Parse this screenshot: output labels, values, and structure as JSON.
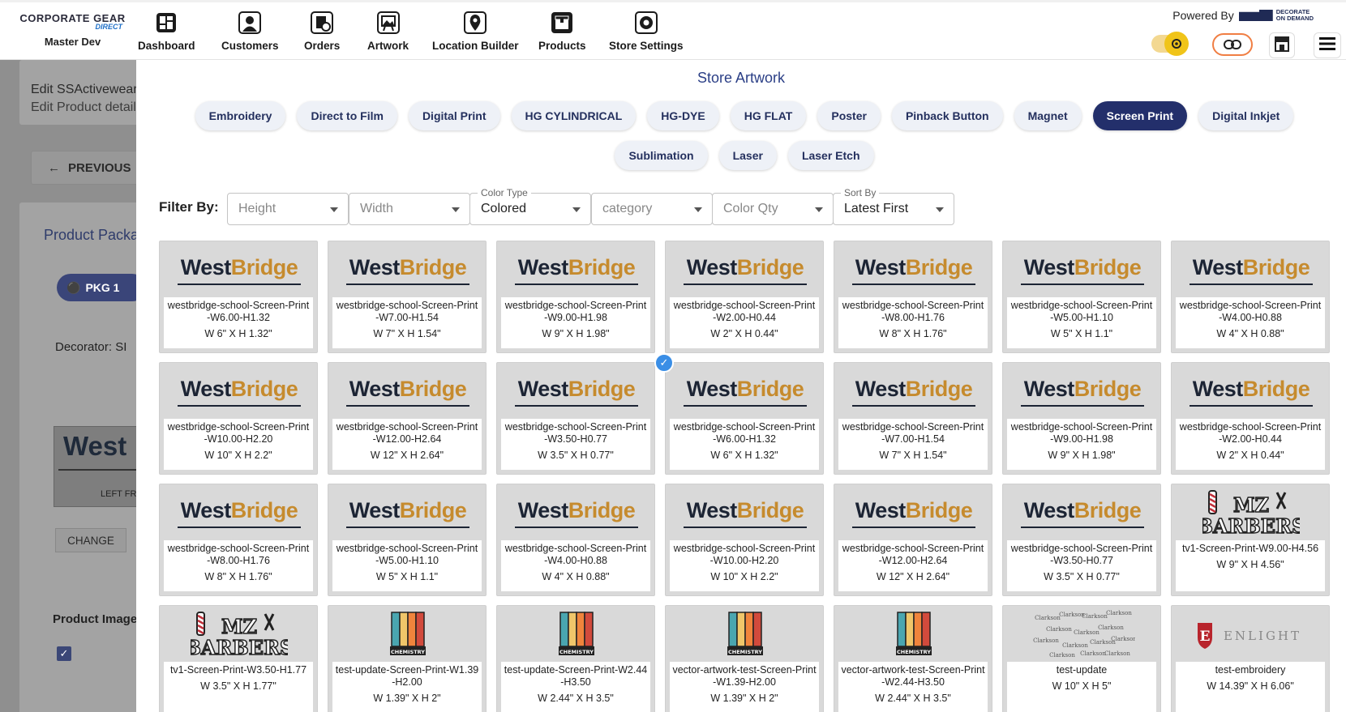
{
  "brand": {
    "name": "CORPORATE GEAR",
    "sub": "DIRECT",
    "store": "Master Dev"
  },
  "nav": [
    {
      "label": "Dashboard",
      "icon": "dashboard-icon"
    },
    {
      "label": "Customers",
      "icon": "customers-icon"
    },
    {
      "label": "Orders",
      "icon": "orders-icon"
    },
    {
      "label": "Artwork",
      "icon": "artwork-icon"
    },
    {
      "label": "Location Builder",
      "icon": "location-pin-icon"
    },
    {
      "label": "Products",
      "icon": "products-icon"
    },
    {
      "label": "Store Settings",
      "icon": "store-settings-icon"
    }
  ],
  "powered_by": {
    "text": "Powered By",
    "logo_line1": "DECORATE",
    "logo_line2": "ON DEMAND"
  },
  "background": {
    "edit_title": "Edit SSActivewear",
    "edit_sub": "Edit Product details",
    "previous": "PREVIOUS",
    "product_pack": "Product Package",
    "pkg": "PKG 1",
    "decorator": "Decorator: SI",
    "thumb_word": "West",
    "thumb_left": "LEFT FR",
    "change": "CHANGE",
    "product_images": "Product Images"
  },
  "panel": {
    "title": "Store Artwork",
    "tabs": [
      "Embroidery",
      "Direct to Film",
      "Digital Print",
      "HG CYLINDRICAL",
      "HG-DYE",
      "HG FLAT",
      "Poster",
      "Pinback Button",
      "Magnet",
      "Screen Print",
      "Digital Inkjet",
      "Sublimation",
      "Laser",
      "Laser Etch"
    ],
    "active_tab": "Screen Print",
    "filter_label": "Filter By:",
    "filters": [
      {
        "caption": "",
        "value": "Height",
        "placeholder": true
      },
      {
        "caption": "",
        "value": "Width",
        "placeholder": true
      },
      {
        "caption": "Color Type",
        "value": "Colored",
        "placeholder": false
      },
      {
        "caption": "",
        "value": "category",
        "placeholder": true
      },
      {
        "caption": "",
        "value": "Color Qty",
        "placeholder": true
      },
      {
        "caption": "Sort By",
        "value": "Latest First",
        "placeholder": false
      }
    ]
  },
  "artworks": [
    {
      "art": "westbridge",
      "name": "westbridge-school-Screen-Print-W6.00-H1.32",
      "dims": "W 6\" X H 1.32\"",
      "selected": false
    },
    {
      "art": "westbridge",
      "name": "westbridge-school-Screen-Print-W7.00-H1.54",
      "dims": "W 7\" X H 1.54\"",
      "selected": false
    },
    {
      "art": "westbridge",
      "name": "westbridge-school-Screen-Print-W9.00-H1.98",
      "dims": "W 9\" X H 1.98\"",
      "selected": false
    },
    {
      "art": "westbridge",
      "name": "westbridge-school-Screen-Print-W2.00-H0.44",
      "dims": "W 2\" X H 0.44\"",
      "selected": false
    },
    {
      "art": "westbridge",
      "name": "westbridge-school-Screen-Print-W8.00-H1.76",
      "dims": "W 8\" X H 1.76\"",
      "selected": false
    },
    {
      "art": "westbridge",
      "name": "westbridge-school-Screen-Print-W5.00-H1.10",
      "dims": "W 5\" X H 1.1\"",
      "selected": false
    },
    {
      "art": "westbridge",
      "name": "westbridge-school-Screen-Print-W4.00-H0.88",
      "dims": "W 4\" X H 0.88\"",
      "selected": false
    },
    {
      "art": "westbridge",
      "name": "westbridge-school-Screen-Print-W10.00-H2.20",
      "dims": "W 10\" X H 2.2\"",
      "selected": false
    },
    {
      "art": "westbridge",
      "name": "westbridge-school-Screen-Print-W12.00-H2.64",
      "dims": "W 12\" X H 2.64\"",
      "selected": false
    },
    {
      "art": "westbridge",
      "name": "westbridge-school-Screen-Print-W3.50-H0.77",
      "dims": "W 3.5\" X H 0.77\"",
      "selected": false
    },
    {
      "art": "westbridge",
      "name": "westbridge-school-Screen-Print-W6.00-H1.32",
      "dims": "W 6\" X H 1.32\"",
      "selected": true
    },
    {
      "art": "westbridge",
      "name": "westbridge-school-Screen-Print-W7.00-H1.54",
      "dims": "W 7\" X H 1.54\"",
      "selected": false
    },
    {
      "art": "westbridge",
      "name": "westbridge-school-Screen-Print-W9.00-H1.98",
      "dims": "W 9\" X H 1.98\"",
      "selected": false
    },
    {
      "art": "westbridge",
      "name": "westbridge-school-Screen-Print-W2.00-H0.44",
      "dims": "W 2\" X H 0.44\"",
      "selected": false
    },
    {
      "art": "westbridge",
      "name": "westbridge-school-Screen-Print-W8.00-H1.76",
      "dims": "W 8\" X H 1.76\"",
      "selected": false
    },
    {
      "art": "westbridge",
      "name": "westbridge-school-Screen-Print-W5.00-H1.10",
      "dims": "W 5\" X H 1.1\"",
      "selected": false
    },
    {
      "art": "westbridge",
      "name": "westbridge-school-Screen-Print-W4.00-H0.88",
      "dims": "W 4\" X H 0.88\"",
      "selected": false
    },
    {
      "art": "westbridge",
      "name": "westbridge-school-Screen-Print-W10.00-H2.20",
      "dims": "W 10\" X H 2.2\"",
      "selected": false
    },
    {
      "art": "westbridge",
      "name": "westbridge-school-Screen-Print-W12.00-H2.64",
      "dims": "W 12\" X H 2.64\"",
      "selected": false
    },
    {
      "art": "westbridge",
      "name": "westbridge-school-Screen-Print-W3.50-H0.77",
      "dims": "W 3.5\" X H 0.77\"",
      "selected": false
    },
    {
      "art": "barbers",
      "name": "tv1-Screen-Print-W9.00-H4.56",
      "dims": "W 9\" X H 4.56\"",
      "selected": false
    },
    {
      "art": "barbers",
      "name": "tv1-Screen-Print-W3.50-H1.77",
      "dims": "W 3.5\" X H 1.77\"",
      "selected": false
    },
    {
      "art": "chemistry",
      "name": "test-update-Screen-Print-W1.39-H2.00",
      "dims": "W 1.39\" X H 2\"",
      "selected": false
    },
    {
      "art": "chemistry",
      "name": "test-update-Screen-Print-W2.44-H3.50",
      "dims": "W 2.44\" X H 3.5\"",
      "selected": false
    },
    {
      "art": "chemistry",
      "name": "vector-artwork-test-Screen-Print-W1.39-H2.00",
      "dims": "W 1.39\" X H 2\"",
      "selected": false
    },
    {
      "art": "chemistry",
      "name": "vector-artwork-test-Screen-Print-W2.44-H3.50",
      "dims": "W 2.44\" X H 3.5\"",
      "selected": false
    },
    {
      "art": "clarkson",
      "name": "test-update",
      "dims": "W 10\" X H 5\"",
      "selected": false
    },
    {
      "art": "enlight",
      "name": "test-embroidery",
      "dims": "W 14.39\" X H 6.06\"",
      "selected": false
    }
  ],
  "art_text": {
    "westbridge_w": "West",
    "westbridge_b": "Bridge",
    "barbers_top": "MZ",
    "barbers_bottom": "BARBERS",
    "chemistry": "CHEMISTRY",
    "clarkson": "Clarkson",
    "enlight_letter": "E",
    "enlight_word": "ENLIGHT"
  },
  "colors": {
    "accent": "#232f6b",
    "title": "#2b3f86",
    "gold": "#c68b2e",
    "navy": "#1c2434",
    "link_border": "#f07e43",
    "toggle": "#f0c419",
    "check": "#3a8ee6"
  }
}
